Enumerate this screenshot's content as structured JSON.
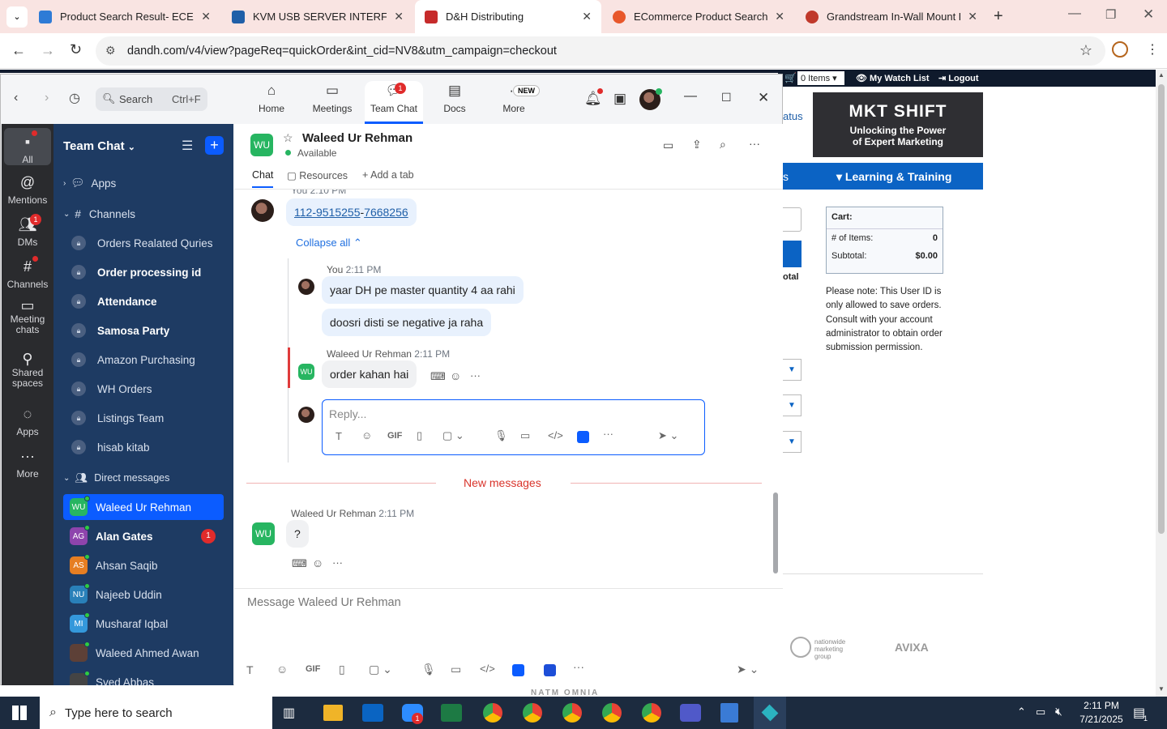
{
  "browser": {
    "tabs": [
      {
        "title": "Product Search Result- ECExpre",
        "color": "#2e7bd6"
      },
      {
        "title": "KVM USB SERVER INTERFACE U",
        "color": "#1f5fa8"
      },
      {
        "title": "D&H Distributing",
        "color": "#c62b2b"
      },
      {
        "title": "ECommerce Product Search",
        "color": "#e8572a"
      },
      {
        "title": "Grandstream In-Wall Mount Kit",
        "color": "#c0392b"
      }
    ],
    "url": "dandh.com/v4/view?pageReq=quickOrder&int_cid=NV8&utm_campaign=checkout"
  },
  "site": {
    "items_label": "0 Items",
    "watchlist": "My Watch List",
    "logout": "Logout",
    "status_fragment": "atus",
    "banner_title": "MKT SHIFT",
    "banner_sub1": "Unlocking the Power",
    "banner_sub2": "of Expert Marketing",
    "learning": "Learning & Training",
    "cart_title": "Cart:",
    "items_count_label": "# of Items:",
    "items_count": "0",
    "subtotal_label": "Subtotal:",
    "subtotal": "$0.00",
    "total_fragment": "otal",
    "note": "Please note: This User ID is only allowed to save orders. Consult with your account administrator to obtain order submission permission.",
    "nmg": "nationwide marketing group",
    "avixa": "AVIXA",
    "bottom_logos": "NATM   OMNIA"
  },
  "zoom": {
    "search_placeholder": "Search",
    "search_shortcut": "Ctrl+F",
    "nav": [
      {
        "label": "Home"
      },
      {
        "label": "Meetings"
      },
      {
        "label": "Team Chat",
        "badge": "1"
      },
      {
        "label": "Docs"
      },
      {
        "label": "More",
        "badge": "NEW"
      }
    ],
    "rail": [
      {
        "label": "All"
      },
      {
        "label": "Mentions"
      },
      {
        "label": "DMs",
        "badge": "1"
      },
      {
        "label": "Channels"
      },
      {
        "label": "Meeting chats"
      },
      {
        "label": "Shared spaces"
      },
      {
        "label": "Apps"
      },
      {
        "label": "More"
      }
    ],
    "sidebar_title": "Team Chat",
    "apps_label": "Apps",
    "channels_label": "Channels",
    "channels": [
      {
        "name": "Orders Realated Quries",
        "bold": false
      },
      {
        "name": "Order processing id",
        "bold": true
      },
      {
        "name": "Attendance",
        "bold": true
      },
      {
        "name": "Samosa Party",
        "bold": true
      },
      {
        "name": "Amazon Purchasing",
        "bold": false
      },
      {
        "name": "WH Orders",
        "bold": false
      },
      {
        "name": "Listings Team",
        "bold": false
      },
      {
        "name": "hisab kitab",
        "bold": false
      }
    ],
    "dm_label": "Direct messages",
    "dms": [
      {
        "initials": "WU",
        "name": "Waleed Ur Rehman",
        "color": "#27b561",
        "active": true
      },
      {
        "initials": "AG",
        "name": "Alan Gates",
        "color": "#8e44ad",
        "bold": true,
        "badge": "1"
      },
      {
        "initials": "AS",
        "name": "Ahsan Saqib",
        "color": "#e67e22"
      },
      {
        "initials": "NU",
        "name": "Najeeb Uddin",
        "color": "#2980b9"
      },
      {
        "initials": "MI",
        "name": "Musharaf Iqbal",
        "color": "#3498db"
      },
      {
        "initials": "",
        "name": "Waleed Ahmed Awan",
        "color": "#5d4037"
      },
      {
        "initials": "",
        "name": "Syed Abbas",
        "color": "#444"
      }
    ],
    "chat": {
      "contact_initials": "WU",
      "contact_name": "Waleed Ur Rehman",
      "status": "Available",
      "tabs": [
        "Chat",
        "Resources",
        "Add a tab"
      ],
      "msg1_meta": "You 2:10 PM",
      "msg1_link1": "112-9515255",
      "msg1_link2": "7668256",
      "collapse": "Collapse all",
      "msg2_meta_name": "You",
      "msg2_meta_time": "2:11 PM",
      "msg2": "yaar DH pe master quantity 4 aa rahi",
      "msg3": "doosri disti se negative ja raha",
      "msg4_meta_name": "Waleed Ur Rehman",
      "msg4_meta_time": "2:11 PM",
      "msg4": "order kahan hai",
      "reply_placeholder": "Reply...",
      "new_messages": "New messages",
      "msg5_meta_name": "Waleed Ur Rehman",
      "msg5_meta_time": "2:11 PM",
      "msg5": "?",
      "compose_placeholder": "Message Waleed Ur Rehman",
      "gif": "GIF"
    }
  },
  "taskbar": {
    "search_placeholder": "Type here to search",
    "time": "2:11 PM",
    "date": "7/21/2025",
    "notif": "1"
  }
}
